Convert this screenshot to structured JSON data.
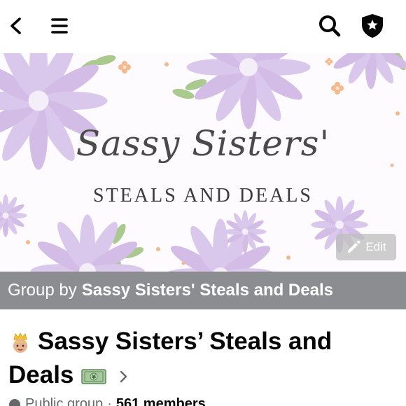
{
  "topbar": {
    "icons": [
      "back-icon",
      "menu-icon",
      "search-icon",
      "admin-shield-icon"
    ]
  },
  "cover": {
    "title": "Sassy Sisters'",
    "subtitle": "STEALS AND DEALS",
    "edit_label": "Edit",
    "colors": {
      "flower": "#d9c6ea",
      "leaf": "#a9c98f",
      "dot": "#f2b98c"
    }
  },
  "group_by": {
    "prefix": "Group by",
    "owner": "Sassy Sisters' Steals and Deals"
  },
  "group": {
    "name_line1": "Sassy Sisters’ Steals and",
    "name_line2": "Deals"
  },
  "meta": {
    "privacy": "Public group",
    "separator": "·",
    "members": "561 members"
  }
}
